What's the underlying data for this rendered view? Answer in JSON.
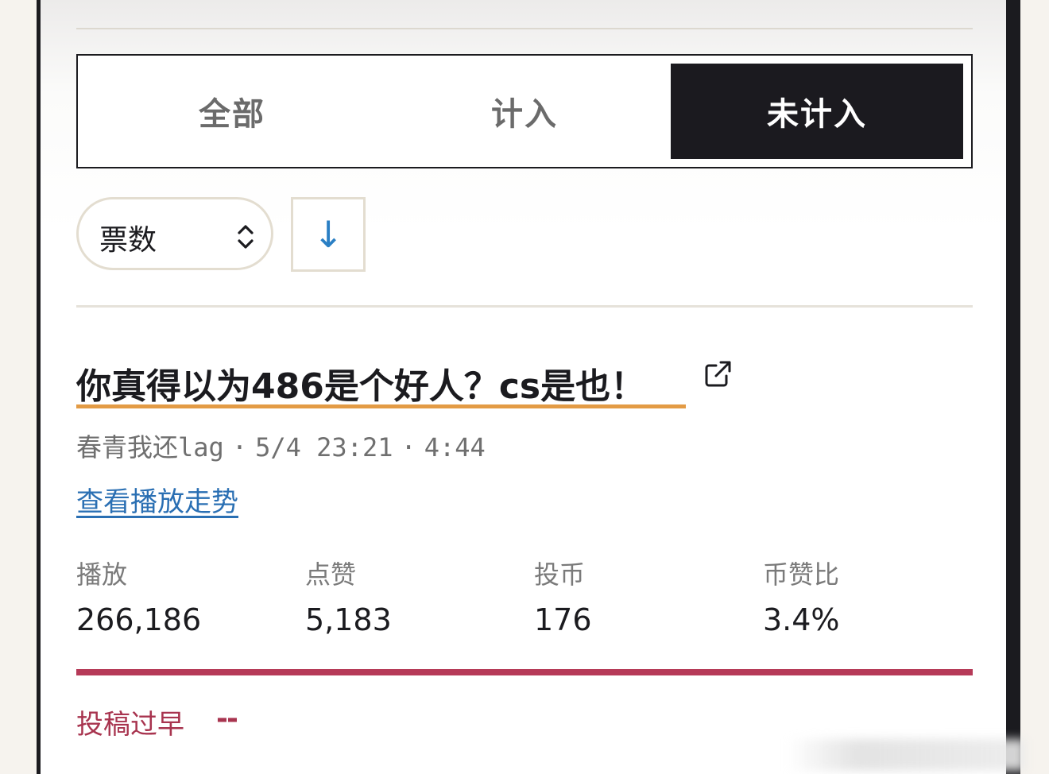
{
  "tabs": [
    {
      "label": "全部",
      "active": false
    },
    {
      "label": "计入",
      "active": false
    },
    {
      "label": "未计入",
      "active": true
    }
  ],
  "sort": {
    "field_label": "票数",
    "caret_icon": "up-down-chevron-icon",
    "direction_label": "↓"
  },
  "video": {
    "title": "你真得以为486是个好人？cs是也！",
    "external_icon": "external-link-icon",
    "uploader": "春青我还lag",
    "separator": "·",
    "datetime": "5/4 23:21",
    "duration": "4:44",
    "trend_link": "查看播放走势",
    "stats": [
      {
        "label": "播放",
        "value": "266,186"
      },
      {
        "label": "点赞",
        "value": "5,183"
      },
      {
        "label": "投币",
        "value": "176"
      },
      {
        "label": "币赞比",
        "value": "3.4%"
      }
    ],
    "status_label": "投稿过早",
    "status_value": "--"
  },
  "colors": {
    "accent_underline": "#e39b45",
    "status_red": "#b63a58",
    "link_blue": "#2a6fb3",
    "active_tab_bg": "#1b1a1f"
  }
}
